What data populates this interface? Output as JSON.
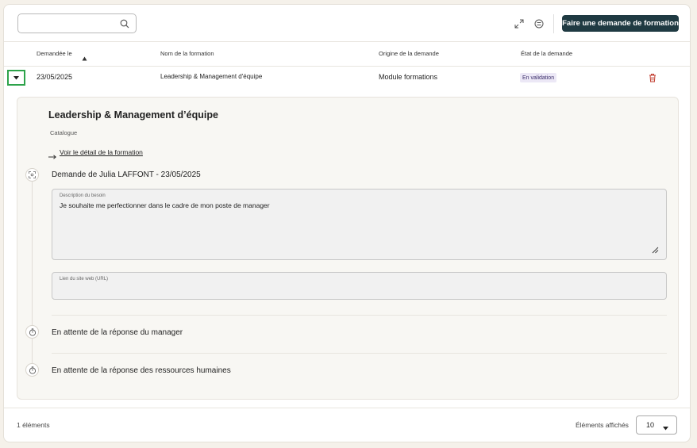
{
  "toolbar": {
    "search": {
      "placeholder": ""
    },
    "primary_button_label": "Faire une demande de formation",
    "icons": [
      "expand-icon",
      "settings-filter-icon",
      "search-icon"
    ]
  },
  "table": {
    "headers": {
      "requested_on": "Demandée le",
      "training_name": "Nom de la formation",
      "origin": "Origine de la demande",
      "status": "État de la demande"
    },
    "rows": [
      {
        "date": "23/05/2025",
        "name": "Leadership & Management d'équipe",
        "origin": "Module formations",
        "status": "En validation"
      }
    ]
  },
  "detail": {
    "title": "Leadership & Management d’équipe",
    "catalog": "Catalogue",
    "link_label": "Voir le détail de la formation",
    "request_heading": "Demande de Julia LAFFONT - 23/05/2025",
    "description": {
      "label": "Description du besoin",
      "value": "Je souhaite me perfectionner dans le cadre de mon poste de manager"
    },
    "url_field": {
      "label": "Lien du site web (URL)",
      "value": ""
    },
    "steps": [
      "En attente de la réponse du manager",
      "En attente de la réponse des ressources humaines"
    ]
  },
  "footer": {
    "count": "1 éléments",
    "page_size_label": "Éléments affichés",
    "page_size_value": "10"
  },
  "colors": {
    "primary": "#1f3a42",
    "badge_bg": "#ece8f6",
    "delete": "#c0392b",
    "focus": "#2da34a"
  }
}
